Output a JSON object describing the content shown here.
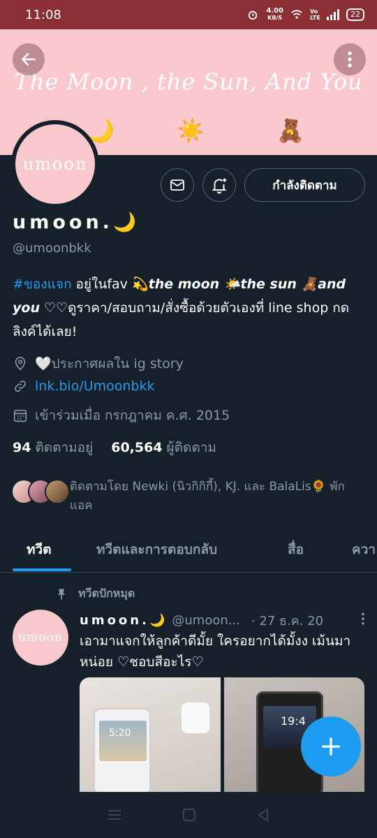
{
  "status_bar": {
    "time": "11:08",
    "net_speed_value": "4.00",
    "net_speed_unit": "KB/S",
    "volte": "Vo LTE",
    "battery": "22"
  },
  "banner": {
    "title": "The Moon , the Sun, And You",
    "emojis": [
      "🌙",
      "☀️",
      "🧸"
    ],
    "color": "#f9c9cd"
  },
  "profile": {
    "avatar_text": "umoon",
    "follow_state_label": "กำลังติดตาม",
    "name": "umoon.🌙",
    "handle": "@umoonbkk",
    "bio": {
      "hashtag": "#ของแจก",
      "part1": " อยู่ในfav 💫",
      "bold1": "the moon 🌤️the sun 🧸and you",
      "part2": " ♡♡ดูราคา/สอบถาม/สั่งซื้อด้วยตัวเองที่ line shop กดลิงค์ได้เลย!"
    },
    "location": "🤍ประกาศผลใน ig story",
    "website": "lnk.bio/Umoonbkk",
    "joined": "เข้าร่วมเมื่อ กรกฎาคม ค.ศ. 2015",
    "following_count": "94",
    "following_label": "ติดตามอยู่",
    "followers_count": "60,564",
    "followers_label": "ผู้ติดตาม",
    "followed_by_text": "ติดตามโดย Newki (นิวกิกิกี้), KJ. และ BalaLis🌻 พักแอค"
  },
  "tabs": [
    {
      "label": "ทวีต",
      "active": true
    },
    {
      "label": "ทวีตและการตอบกลับ",
      "active": false
    },
    {
      "label": "สื่อ",
      "active": false
    },
    {
      "label": "ควา",
      "active": false
    }
  ],
  "pinned_tweet": {
    "pinned_label": "ทวีตปักหมุด",
    "avatar_text": "umoon",
    "name": "umoon.🌙",
    "handle": "@umoon...",
    "date": "· 27 ธ.ค. 20",
    "text": "เอามาแจกให้ลูกค้าดีมั้ย ใครอยากได้มั้งง เม้นมาหน่อย ♡ชอบสีอะไร♡",
    "media": [
      {
        "phone_time": "5:20"
      },
      {
        "phone_time": "19:4"
      }
    ]
  },
  "colors": {
    "accent": "#1d9bf0",
    "background": "#15202b",
    "status_bar": "#8b2f35",
    "muted_text": "#8b98a5"
  }
}
